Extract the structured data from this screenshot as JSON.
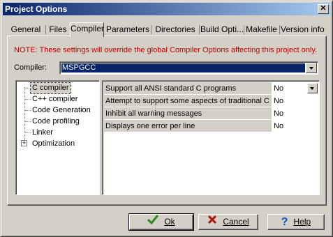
{
  "window": {
    "title": "Project Options",
    "close_label": "✕"
  },
  "tabs": [
    {
      "label": "General"
    },
    {
      "label": "Files"
    },
    {
      "label": "Compiler",
      "active": true
    },
    {
      "label": "Parameters"
    },
    {
      "label": "Directories"
    },
    {
      "label": "Build Opti..."
    },
    {
      "label": "Makefile"
    },
    {
      "label": "Version info"
    }
  ],
  "note": "NOTE: These settings will override the global Compiler Options affecting this project only.",
  "compiler": {
    "label": "Compiler:",
    "selected": "MSPGCC"
  },
  "tree": {
    "items": [
      {
        "label": "C compiler",
        "selected": true
      },
      {
        "label": "C++ compiler"
      },
      {
        "label": "Code Generation"
      },
      {
        "label": "Code profiling"
      },
      {
        "label": "Linker"
      },
      {
        "label": "Optimization",
        "expandable": true
      }
    ],
    "expander_glyph": "+"
  },
  "properties": [
    {
      "name": "Support all ANSI standard C programs",
      "value": "No"
    },
    {
      "name": "Attempt to support some aspects of traditional C preprocessors",
      "value": "No"
    },
    {
      "name": "Inhibit all warning messages",
      "value": "No"
    },
    {
      "name": "Displays one error per line",
      "value": "No"
    }
  ],
  "buttons": {
    "ok": "Ok",
    "cancel": "Cancel",
    "help": "Help"
  },
  "colors": {
    "note": "#c00000",
    "selection": "#0a246a",
    "face": "#d4d0c8",
    "ok_check": "#2a8a1a",
    "cancel_x": "#b01010",
    "help_q": "#1050c0"
  }
}
